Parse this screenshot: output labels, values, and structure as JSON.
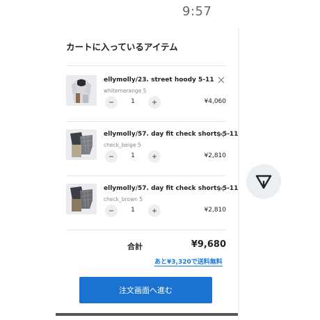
{
  "status": {
    "time": "9:57"
  },
  "cart": {
    "title": "カートに入っているアイテム",
    "items": [
      {
        "name": "ellymolly/23. street hoody 5-11",
        "variant": "whitemerange 5",
        "quantity": "1",
        "price": "¥4,060",
        "thumbnail": "hoody-photo"
      },
      {
        "name": "ellymolly/57. day fit check shorts 5-11",
        "variant": "check_beige 5",
        "quantity": "1",
        "price": "¥2,810",
        "thumbnail": "shorts-photo"
      },
      {
        "name": "ellymolly/57. day fit check shorts 5-11",
        "variant": "check_brown 5",
        "quantity": "1",
        "price": "¥2,810",
        "thumbnail": "shorts-photo"
      }
    ],
    "total_label": "合計",
    "total_value": "¥9,680",
    "free_shipping_note": "あと¥3,320で送料無料",
    "checkout_label": "注文画面へ進む"
  },
  "icons": {
    "remove": "close-icon",
    "decrease": "minus-icon",
    "increase": "plus-icon",
    "fab": "arrow-down-triangle-icon"
  },
  "colors": {
    "accent": "#1a73d1",
    "link": "#1a7ad4"
  }
}
